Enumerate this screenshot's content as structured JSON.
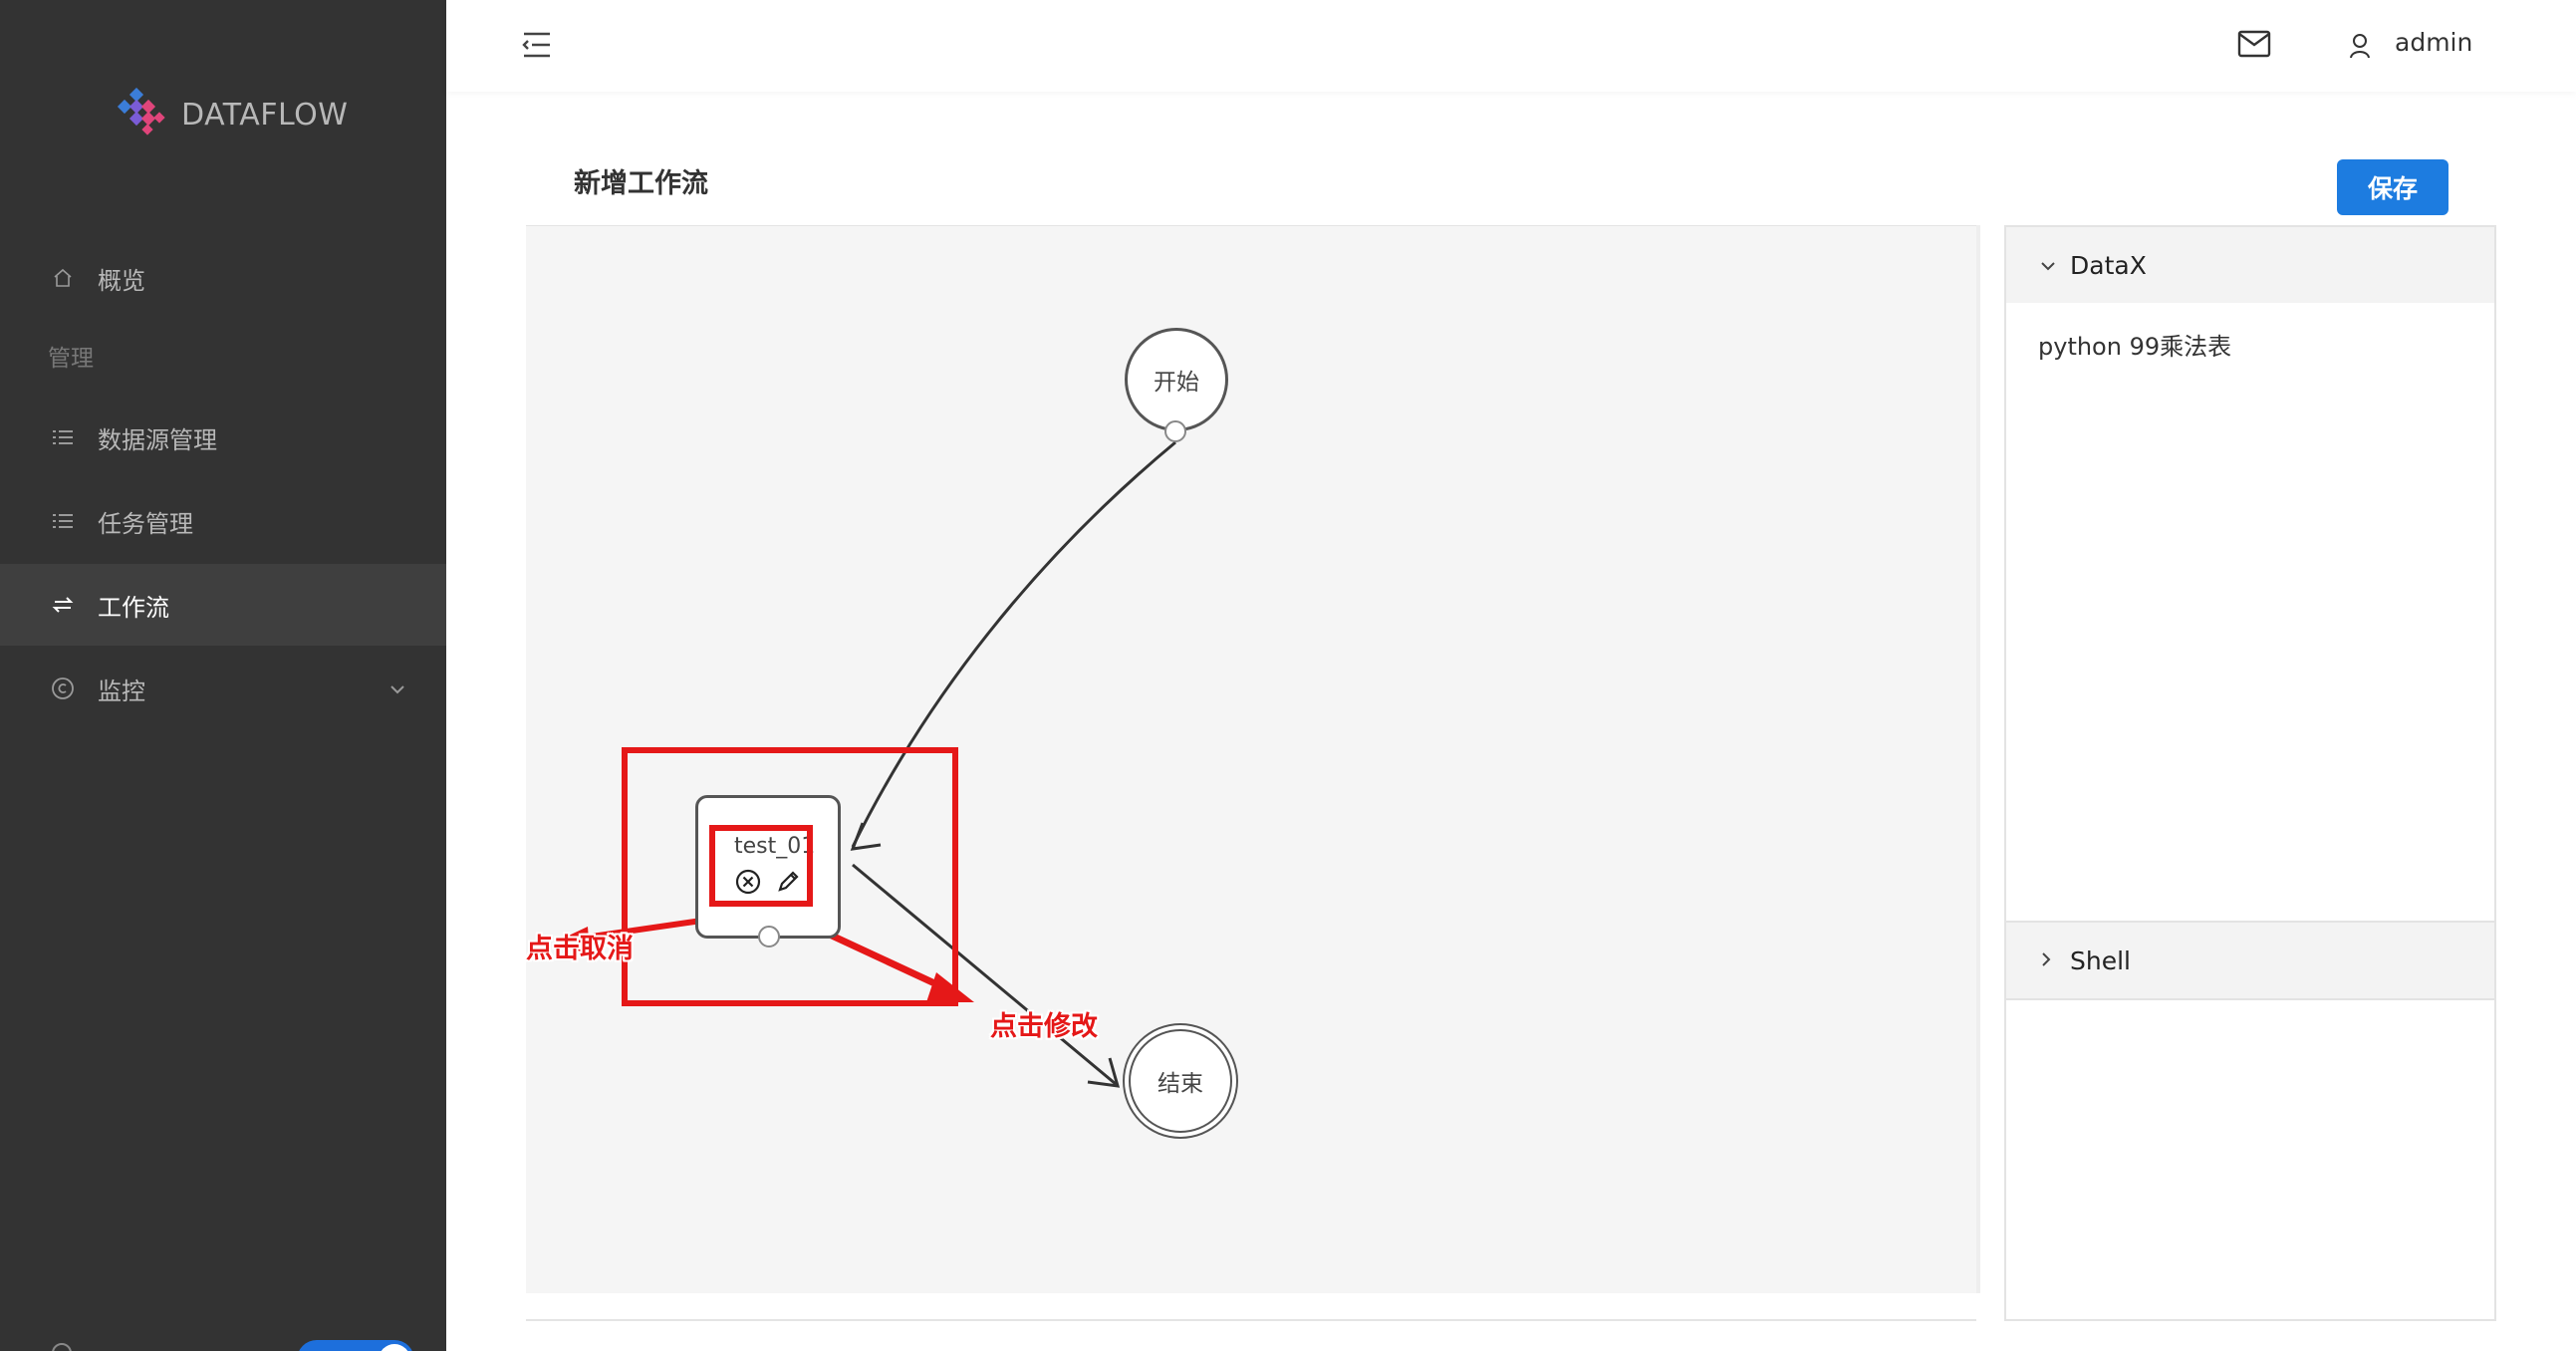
{
  "app": {
    "logo_text": "DATAFLOW"
  },
  "sidebar": {
    "group_label": "管理",
    "items": [
      {
        "label": "概览",
        "icon": "home-icon"
      },
      {
        "label": "数据源管理",
        "icon": "list-icon"
      },
      {
        "label": "任务管理",
        "icon": "list-icon"
      },
      {
        "label": "工作流",
        "icon": "swap-icon",
        "active": true
      },
      {
        "label": "监控",
        "icon": "copyright-icon"
      }
    ]
  },
  "header": {
    "username": "admin"
  },
  "page": {
    "title": "新增工作流",
    "save_label": "保存"
  },
  "canvas": {
    "start_label": "开始",
    "end_label": "结束",
    "task_name": "test_01",
    "annotation_cancel": "点击取消",
    "annotation_edit": "点击修改"
  },
  "panel": {
    "sections": [
      {
        "title": "DataX",
        "expanded": true,
        "items": [
          "python 99乘法表"
        ]
      },
      {
        "title": "Shell",
        "expanded": false,
        "items": []
      }
    ]
  },
  "colors": {
    "sidebar_bg": "#333333",
    "accent": "#1d7ce0",
    "annotation": "#e51818"
  }
}
